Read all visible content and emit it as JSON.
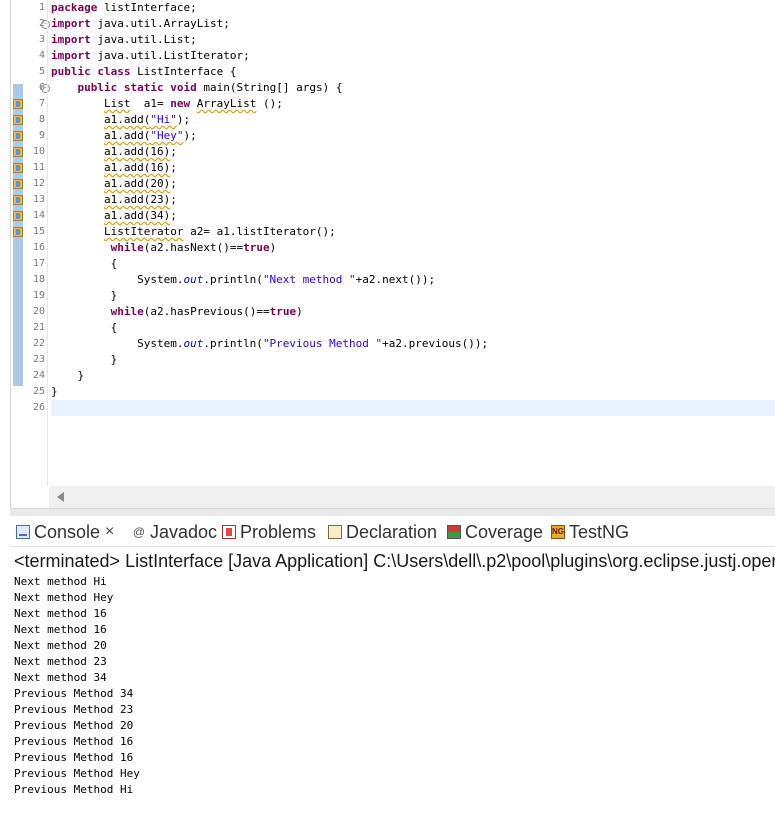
{
  "editor": {
    "lines": [
      {
        "n": "1",
        "tokens": [
          {
            "t": "package",
            "c": "kw"
          },
          {
            "t": " listInterface;"
          }
        ]
      },
      {
        "n": "2",
        "fold": "-",
        "tokens": [
          {
            "t": "import",
            "c": "kw"
          },
          {
            "t": " java.util.ArrayList;"
          }
        ]
      },
      {
        "n": "3",
        "tokens": [
          {
            "t": "import",
            "c": "kw"
          },
          {
            "t": " java.util.List;"
          }
        ]
      },
      {
        "n": "4",
        "tokens": [
          {
            "t": "import",
            "c": "kw"
          },
          {
            "t": " java.util.ListIterator;"
          }
        ]
      },
      {
        "n": "5",
        "tokens": [
          {
            "t": "public",
            "c": "kw"
          },
          {
            "t": " "
          },
          {
            "t": "class",
            "c": "kw"
          },
          {
            "t": " ListInterface {"
          }
        ]
      },
      {
        "n": "6",
        "fold": "-",
        "tokens": [
          {
            "t": "    "
          },
          {
            "t": "public",
            "c": "kw"
          },
          {
            "t": " "
          },
          {
            "t": "static",
            "c": "kw"
          },
          {
            "t": " "
          },
          {
            "t": "void",
            "c": "kw"
          },
          {
            "t": " main(String[] args) {"
          }
        ]
      },
      {
        "n": "7",
        "tokens": [
          {
            "t": "        "
          },
          {
            "t": "List",
            "c": "warnu"
          },
          {
            "t": "  a1= "
          },
          {
            "t": "new",
            "c": "kw"
          },
          {
            "t": " "
          },
          {
            "t": "ArrayList",
            "c": "warnu"
          },
          {
            "t": " ();"
          }
        ]
      },
      {
        "n": "8",
        "tokens": [
          {
            "t": "        "
          },
          {
            "t": "a1.add(",
            "c": "warnu"
          },
          {
            "t": "\"Hi\"",
            "c": "str warnu"
          },
          {
            "t": ");"
          }
        ]
      },
      {
        "n": "9",
        "tokens": [
          {
            "t": "        "
          },
          {
            "t": "a1.add(",
            "c": "warnu"
          },
          {
            "t": "\"Hey\"",
            "c": "str warnu"
          },
          {
            "t": ");"
          }
        ]
      },
      {
        "n": "10",
        "tokens": [
          {
            "t": "        "
          },
          {
            "t": "a1.add(16)",
            "c": "warnu"
          },
          {
            "t": ";"
          }
        ]
      },
      {
        "n": "11",
        "tokens": [
          {
            "t": "        "
          },
          {
            "t": "a1.add(16)",
            "c": "warnu"
          },
          {
            "t": ";"
          }
        ]
      },
      {
        "n": "12",
        "tokens": [
          {
            "t": "        "
          },
          {
            "t": "a1.add(20)",
            "c": "warnu"
          },
          {
            "t": ";"
          }
        ]
      },
      {
        "n": "13",
        "tokens": [
          {
            "t": "        "
          },
          {
            "t": "a1.add(23)",
            "c": "warnu"
          },
          {
            "t": ";"
          }
        ]
      },
      {
        "n": "14",
        "tokens": [
          {
            "t": "        "
          },
          {
            "t": "a1.add(34)",
            "c": "warnu"
          },
          {
            "t": ";"
          }
        ]
      },
      {
        "n": "15",
        "tokens": [
          {
            "t": "        "
          },
          {
            "t": "ListIterator",
            "c": "warnu"
          },
          {
            "t": " a2= a1.listIterator();"
          }
        ]
      },
      {
        "n": "16",
        "tokens": [
          {
            "t": "         "
          },
          {
            "t": "while",
            "c": "kw"
          },
          {
            "t": "(a2.hasNext()=="
          },
          {
            "t": "true",
            "c": "kw"
          },
          {
            "t": ")"
          }
        ]
      },
      {
        "n": "17",
        "tokens": [
          {
            "t": "         {"
          }
        ]
      },
      {
        "n": "18",
        "tokens": [
          {
            "t": "             System."
          },
          {
            "t": "out",
            "c": "fld"
          },
          {
            "t": ".println("
          },
          {
            "t": "\"Next method \"",
            "c": "str"
          },
          {
            "t": "+a2.next());"
          }
        ]
      },
      {
        "n": "19",
        "tokens": [
          {
            "t": "         }"
          }
        ]
      },
      {
        "n": "20",
        "tokens": [
          {
            "t": "         "
          },
          {
            "t": "while",
            "c": "kw"
          },
          {
            "t": "(a2.hasPrevious()=="
          },
          {
            "t": "true",
            "c": "kw"
          },
          {
            "t": ")"
          }
        ]
      },
      {
        "n": "21",
        "tokens": [
          {
            "t": "         {"
          }
        ]
      },
      {
        "n": "22",
        "tokens": [
          {
            "t": "             System."
          },
          {
            "t": "out",
            "c": "fld"
          },
          {
            "t": ".println("
          },
          {
            "t": "\"Previous Method \"",
            "c": "str"
          },
          {
            "t": "+a2.previous());"
          }
        ]
      },
      {
        "n": "23",
        "tokens": [
          {
            "t": "         }"
          }
        ]
      },
      {
        "n": "24",
        "tokens": [
          {
            "t": "    }"
          }
        ]
      },
      {
        "n": "25",
        "tokens": [
          {
            "t": "}"
          }
        ]
      },
      {
        "n": "26",
        "current": true,
        "tokens": [
          {
            "t": ""
          }
        ]
      }
    ],
    "warning_lines": [
      "7",
      "8",
      "9",
      "10",
      "11",
      "12",
      "13",
      "14",
      "15"
    ]
  },
  "console": {
    "tabs": [
      {
        "id": "console",
        "label": "Console",
        "icon": "console-icon",
        "close": "×"
      },
      {
        "id": "javadoc",
        "label": "Javadoc",
        "icon": "at-icon"
      },
      {
        "id": "problems",
        "label": "Problems",
        "icon": "problems-icon"
      },
      {
        "id": "declaration",
        "label": "Declaration",
        "icon": "declaration-icon"
      },
      {
        "id": "coverage",
        "label": "Coverage",
        "icon": "coverage-icon"
      },
      {
        "id": "testng",
        "label": "TestNG",
        "icon": "testng-icon"
      }
    ],
    "status": "<terminated> ListInterface [Java Application] C:\\Users\\dell\\.p2\\pool\\plugins\\org.eclipse.justj.oper",
    "output": [
      "Next method Hi",
      "Next method Hey",
      "Next method 16",
      "Next method 16",
      "Next method 20",
      "Next method 23",
      "Next method 34",
      "Previous Method 34",
      "Previous Method 23",
      "Previous Method 20",
      "Previous Method 16",
      "Previous Method 16",
      "Previous Method Hey",
      "Previous Method Hi"
    ]
  }
}
